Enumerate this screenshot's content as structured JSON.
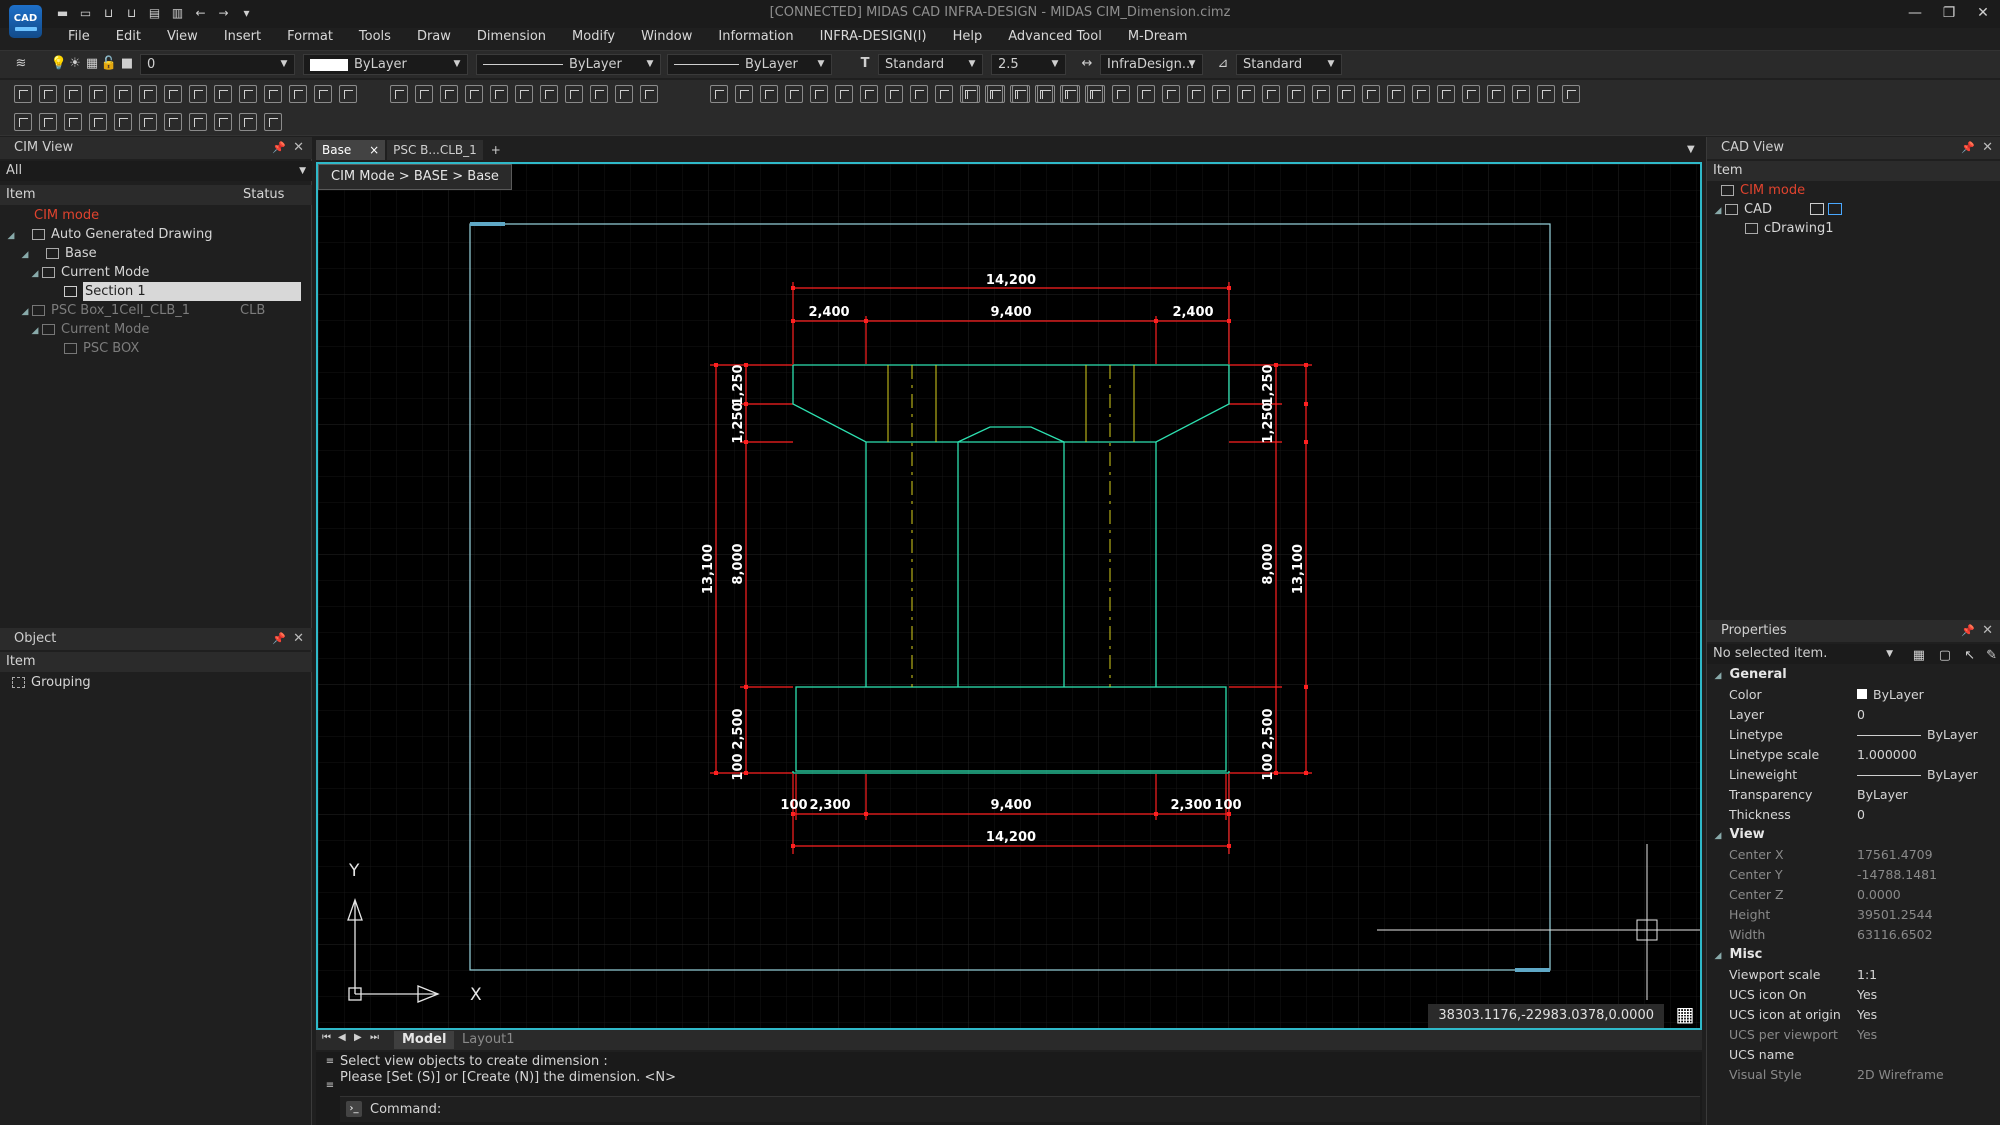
{
  "app": {
    "logo_text": "CAD",
    "title": "[CONNECTED] MIDAS CAD INFRA-DESIGN - MIDAS CIM_Dimension.cimz"
  },
  "menu": [
    "File",
    "Edit",
    "View",
    "Insert",
    "Format",
    "Tools",
    "Draw",
    "Dimension",
    "Modify",
    "Window",
    "Information",
    "INFRA-DESIGN(I)",
    "Help",
    "Advanced Tool",
    "M-Dream"
  ],
  "toolbar": {
    "layer_value": "0",
    "color_value": "ByLayer",
    "linetype_value": "ByLayer",
    "lineweight_value": "ByLayer",
    "text_style": "Standard",
    "text_height": "2.5",
    "dim_style": "InfraDesign...",
    "table_style": "Standard"
  },
  "cim_view": {
    "title": "CIM View",
    "filter": "All",
    "col_item": "Item",
    "col_status": "Status",
    "tree": [
      {
        "label": "CIM mode",
        "status": ""
      },
      {
        "label": "Auto Generated Drawing",
        "status": ""
      },
      {
        "label": "Base",
        "status": ""
      },
      {
        "label": "Current Mode",
        "status": ""
      },
      {
        "label": "Section 1",
        "status": ""
      },
      {
        "label": "PSC Box_1Cell_CLB_1",
        "status": "CLB"
      },
      {
        "label": "Current Mode",
        "status": ""
      },
      {
        "label": "PSC BOX",
        "status": ""
      }
    ]
  },
  "object_panel": {
    "title": "Object",
    "col_item": "Item",
    "items": [
      "Grouping"
    ]
  },
  "doc_tabs": [
    {
      "label": "Base",
      "close": "×"
    },
    {
      "label": "PSC B...CLB_1",
      "close": ""
    },
    {
      "label": "+",
      "close": ""
    }
  ],
  "viewport": {
    "breadcrumb": "CIM Mode > BASE > Base",
    "coords": "38303.1176,-22983.0378,0.0000",
    "ucs_x": "X",
    "ucs_y": "Y"
  },
  "drawing": {
    "top_overall": "14,200",
    "top_left": "2,400",
    "top_mid": "9,400",
    "top_right": "2,400",
    "bot_left_edge": "100",
    "bot_left": "2,300",
    "bot_mid": "9,400",
    "bot_right": "2,300",
    "bot_right_edge": "100",
    "bot_overall": "14,200",
    "left_overall": "13,100",
    "left_flange1": "1,250",
    "left_flange2": "1,250",
    "left_web": "8,000",
    "left_slab": "2,500",
    "left_edge": "100",
    "right_overall": "13,100",
    "right_flange1": "1,250",
    "right_flange2": "1,250",
    "right_web": "8,000",
    "right_slab": "2,500",
    "right_edge": "100",
    "colors": {
      "outline": "#2de0b0",
      "dimension": "#ff2020",
      "center": "#d7d01c",
      "frame": "#9ad6e0"
    }
  },
  "layout_tabs": [
    "Model",
    "Layout1"
  ],
  "command": {
    "line1": "Select view objects to create dimension :",
    "line2": "Please [Set (S)] or [Create (N)] the dimension. <N>",
    "prompt": "Command:"
  },
  "cad_view": {
    "title": "CAD View",
    "col_item": "Item",
    "tree": [
      "CIM mode",
      "CAD",
      "cDrawing1"
    ]
  },
  "properties": {
    "title": "Properties",
    "selection": "No selected item.",
    "sections": {
      "general": "General",
      "view": "View",
      "misc": "Misc"
    },
    "general": [
      {
        "k": "Color",
        "v": "ByLayer"
      },
      {
        "k": "Layer",
        "v": "0"
      },
      {
        "k": "Linetype",
        "v": "ByLayer"
      },
      {
        "k": "Linetype scale",
        "v": "1.000000"
      },
      {
        "k": "Lineweight",
        "v": "ByLayer"
      },
      {
        "k": "Transparency",
        "v": "ByLayer"
      },
      {
        "k": "Thickness",
        "v": "0"
      }
    ],
    "view": [
      {
        "k": "Center X",
        "v": "17561.4709"
      },
      {
        "k": "Center Y",
        "v": "-14788.1481"
      },
      {
        "k": "Center Z",
        "v": "0.0000"
      },
      {
        "k": "Height",
        "v": "39501.2544"
      },
      {
        "k": "Width",
        "v": "63116.6502"
      }
    ],
    "misc": [
      {
        "k": "Viewport scale",
        "v": "1:1"
      },
      {
        "k": "UCS icon On",
        "v": "Yes"
      },
      {
        "k": "UCS icon at origin",
        "v": "Yes"
      },
      {
        "k": "UCS per viewport",
        "v": "Yes"
      },
      {
        "k": "UCS name",
        "v": ""
      },
      {
        "k": "Visual Style",
        "v": "2D Wireframe"
      }
    ]
  }
}
